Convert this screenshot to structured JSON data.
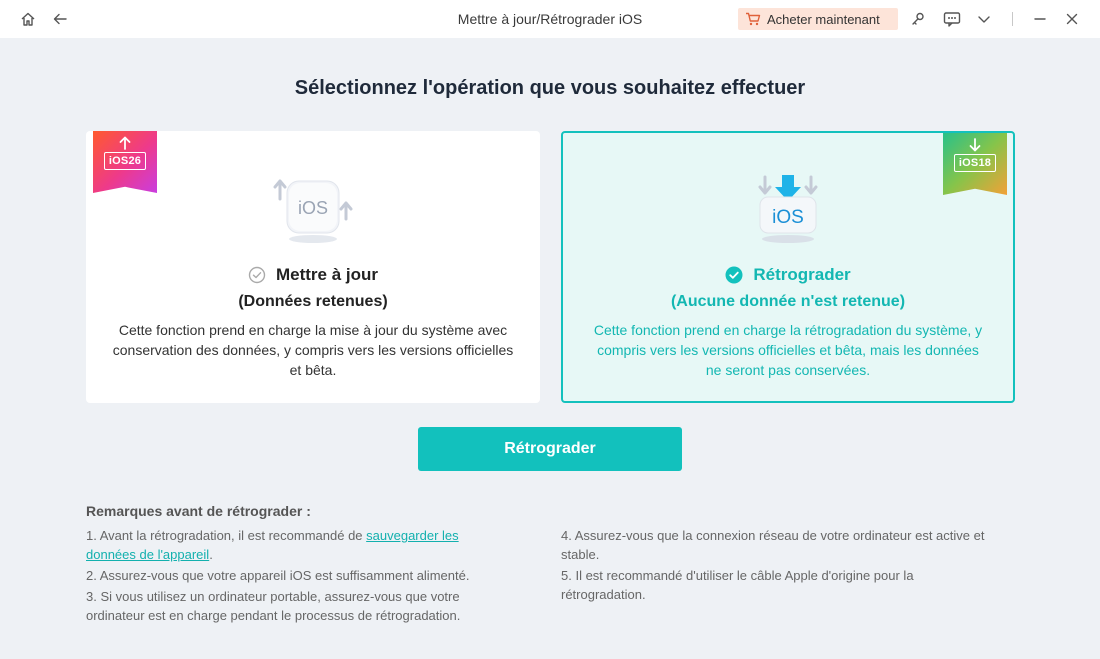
{
  "window": {
    "title": "Mettre à jour/Rétrograder iOS",
    "buy_label": "Acheter maintenant",
    "icons": [
      "home-icon",
      "back-arrow-icon",
      "cart-icon",
      "key-icon",
      "feedback-icon",
      "chevron-down-icon",
      "minimize-icon",
      "close-icon"
    ]
  },
  "heading": "Sélectionnez l'opération que vous souhaitez effectuer",
  "cards": [
    {
      "ribbon": "iOS26",
      "illustration_text": "iOS",
      "title": "Mettre à jour",
      "subtitle": "(Données retenues)",
      "description": "Cette fonction prend en charge la mise à jour du système avec conservation des données, y compris vers les versions officielles et bêta.",
      "selected": false
    },
    {
      "ribbon": "iOS18",
      "illustration_text": "iOS",
      "title": "Rétrograder",
      "subtitle": "(Aucune donnée n'est retenue)",
      "description": "Cette fonction prend en charge la rétrogradation du système, y compris vers les versions officielles et bêta, mais les données ne seront pas conservées.",
      "selected": true
    }
  ],
  "main_button": "Rétrograder",
  "notes": {
    "title": "Remarques avant de rétrograder :",
    "n1_prefix": "1.  Avant la rétrogradation, il est recommandé de ",
    "n1_link": "sauvegarder les données de l'appareil",
    "n1_suffix": ".",
    "n2": "2.  Assurez-vous que votre appareil iOS est suffisamment alimenté.",
    "n3": "3.  Si vous utilisez un ordinateur portable, assurez-vous que votre ordinateur est en charge pendant le processus de rétrogradation.",
    "n4": "4.  Assurez-vous que la connexion réseau de votre ordinateur est active et stable.",
    "n5": "5.  Il est recommandé d'utiliser le câble Apple d'origine pour la rétrogradation."
  },
  "colors": {
    "accent": "#12c1bd",
    "selected_bg": "#e7f8f6",
    "buy_bg": "#fde4d9",
    "page_bg": "#eef1f5"
  }
}
